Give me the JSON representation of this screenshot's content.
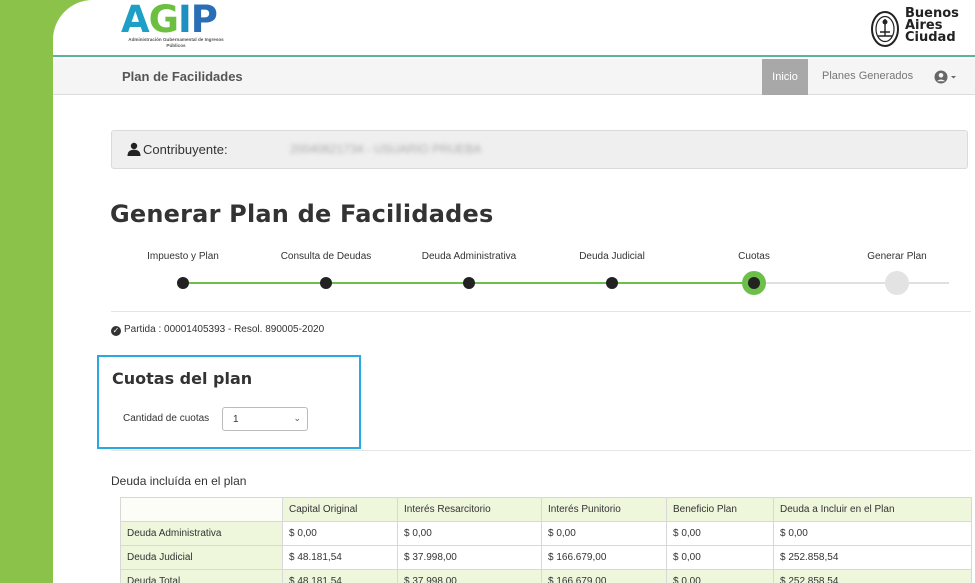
{
  "header": {
    "agip_word": [
      "A",
      "G",
      "I",
      "P"
    ],
    "agip_subtitle": "Administración Gubernamental de Ingresos Públicos",
    "ba_text": [
      "Buenos",
      "Aires",
      "Ciudad"
    ]
  },
  "navbar": {
    "brand": "Plan de Facilidades",
    "home": "Inicio",
    "planes": "Planes Generados",
    "user_icon": "user-circle-icon"
  },
  "contribuyente": {
    "label": "Contribuyente:",
    "value": "20040621734 - USUARIO PRUEBA"
  },
  "title": "Generar Plan de Facilidades",
  "steps": [
    {
      "label": "Impuesto y Plan",
      "state": "done"
    },
    {
      "label": "Consulta de Deudas",
      "state": "done"
    },
    {
      "label": "Deuda Administrativa",
      "state": "done"
    },
    {
      "label": "Deuda Judicial",
      "state": "done"
    },
    {
      "label": "Cuotas",
      "state": "current"
    },
    {
      "label": "Generar Plan",
      "state": "pending"
    }
  ],
  "partida": "Partida : 00001405393 - Resol. 890005-2020",
  "cuotas": {
    "title": "Cuotas del plan",
    "label": "Cantidad de cuotas",
    "selected": "1"
  },
  "deuda": {
    "title": "Deuda incluída en el plan",
    "columns": [
      "Capital Original",
      "Interés Resarcitorio",
      "Interés Punitorio",
      "Beneficio Plan",
      "Deuda a Incluir en el Plan"
    ],
    "rows": [
      {
        "label": "Deuda Administrativa",
        "values": [
          "$ 0,00",
          "$ 0,00",
          "$ 0,00",
          "$ 0,00",
          "$ 0,00"
        ]
      },
      {
        "label": "Deuda Judicial",
        "values": [
          "$ 48.181,54",
          "$ 37.998,00",
          "$ 166.679,00",
          "$ 0,00",
          "$ 252.858,54"
        ]
      },
      {
        "label": "Deuda Total",
        "values": [
          "$ 48.181,54",
          "$ 37.998,00",
          "$ 166.679,00",
          "$ 0,00",
          "$ 252.858,54"
        ]
      }
    ]
  },
  "colors": {
    "side_green": "#8bc34a",
    "step_green": "#6cc04a",
    "highlight_blue": "#29a9e0"
  }
}
